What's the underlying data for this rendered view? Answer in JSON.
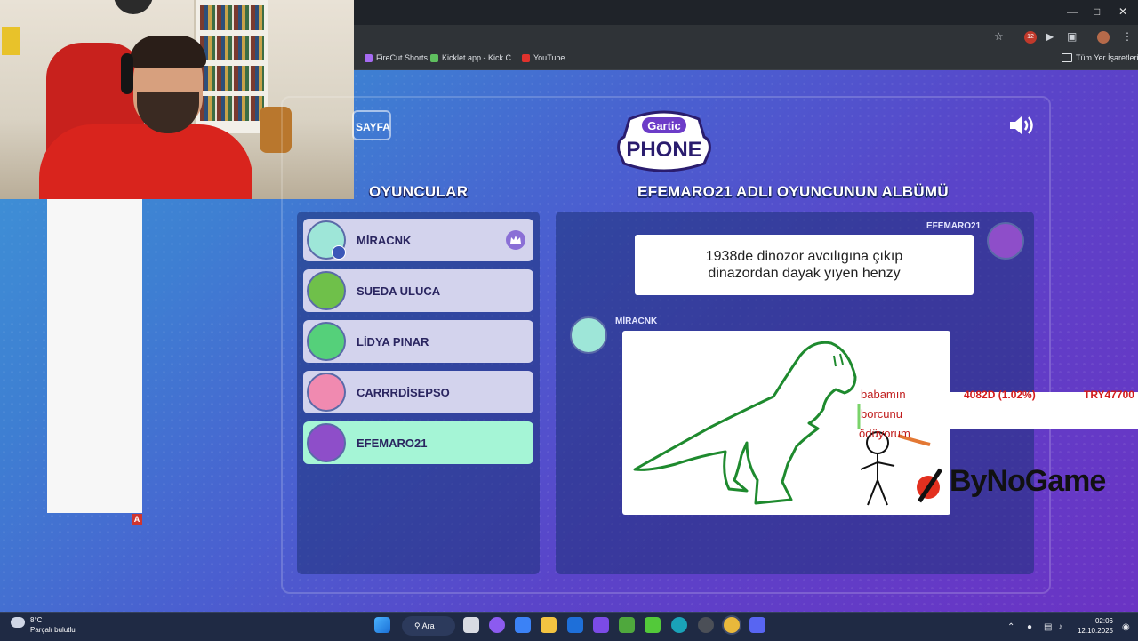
{
  "browser": {
    "bookmarks": [
      {
        "label": "FireCut Shorts",
        "color": "#a66bf2"
      },
      {
        "label": "Kicklet.app - Kick C...",
        "color": "#5fbf5f"
      },
      {
        "label": "YouTube",
        "color": "#e0322d"
      }
    ],
    "all_bookmarks": "Tüm Yer İşaretleri",
    "profile_badge": "12"
  },
  "game": {
    "back_button": "SAYFA",
    "logo_line1": "Gartic",
    "logo_line2": "PHONE",
    "players_heading": "OYUNCULAR",
    "album_heading": "EFEMARO21 ADLI OYUNCUNUN ALBÜMÜ",
    "players": [
      {
        "name": "MİRACNK",
        "avatar_color": "#9ee6d8",
        "host": true,
        "active": false
      },
      {
        "name": "SUEDA ULUCA",
        "avatar_color": "#6fc04a",
        "host": false,
        "active": false
      },
      {
        "name": "LİDYA PINAR",
        "avatar_color": "#55d07a",
        "host": false,
        "active": false
      },
      {
        "name": "CARRRDİSEPSO",
        "avatar_color": "#f08ab0",
        "host": false,
        "active": false
      },
      {
        "name": "EFEMARO21",
        "avatar_color": "#8e4ec9",
        "host": false,
        "active": true
      }
    ],
    "album": {
      "prompt_author": "EFEMARO21",
      "prompt_text": "1938de dinozor avcılıgına çıkıp dinazordan dayak yıyen henzy",
      "drawing_author": "MİRACNK",
      "drawing_text_1": "babamın",
      "drawing_text_2": "borcunu",
      "drawing_text_3": "ödüyorum"
    }
  },
  "overlay": {
    "ticker_1": "4082D (1.02%)",
    "ticker_2": "TRY47700",
    "sponsor": "ByNoGame",
    "corner_badge": "A"
  },
  "taskbar": {
    "weather_temp": "8°C",
    "weather_desc": "Parçalı bulutlu",
    "search_label": "Ara",
    "time": "02:06",
    "date": "12.10.2025"
  }
}
